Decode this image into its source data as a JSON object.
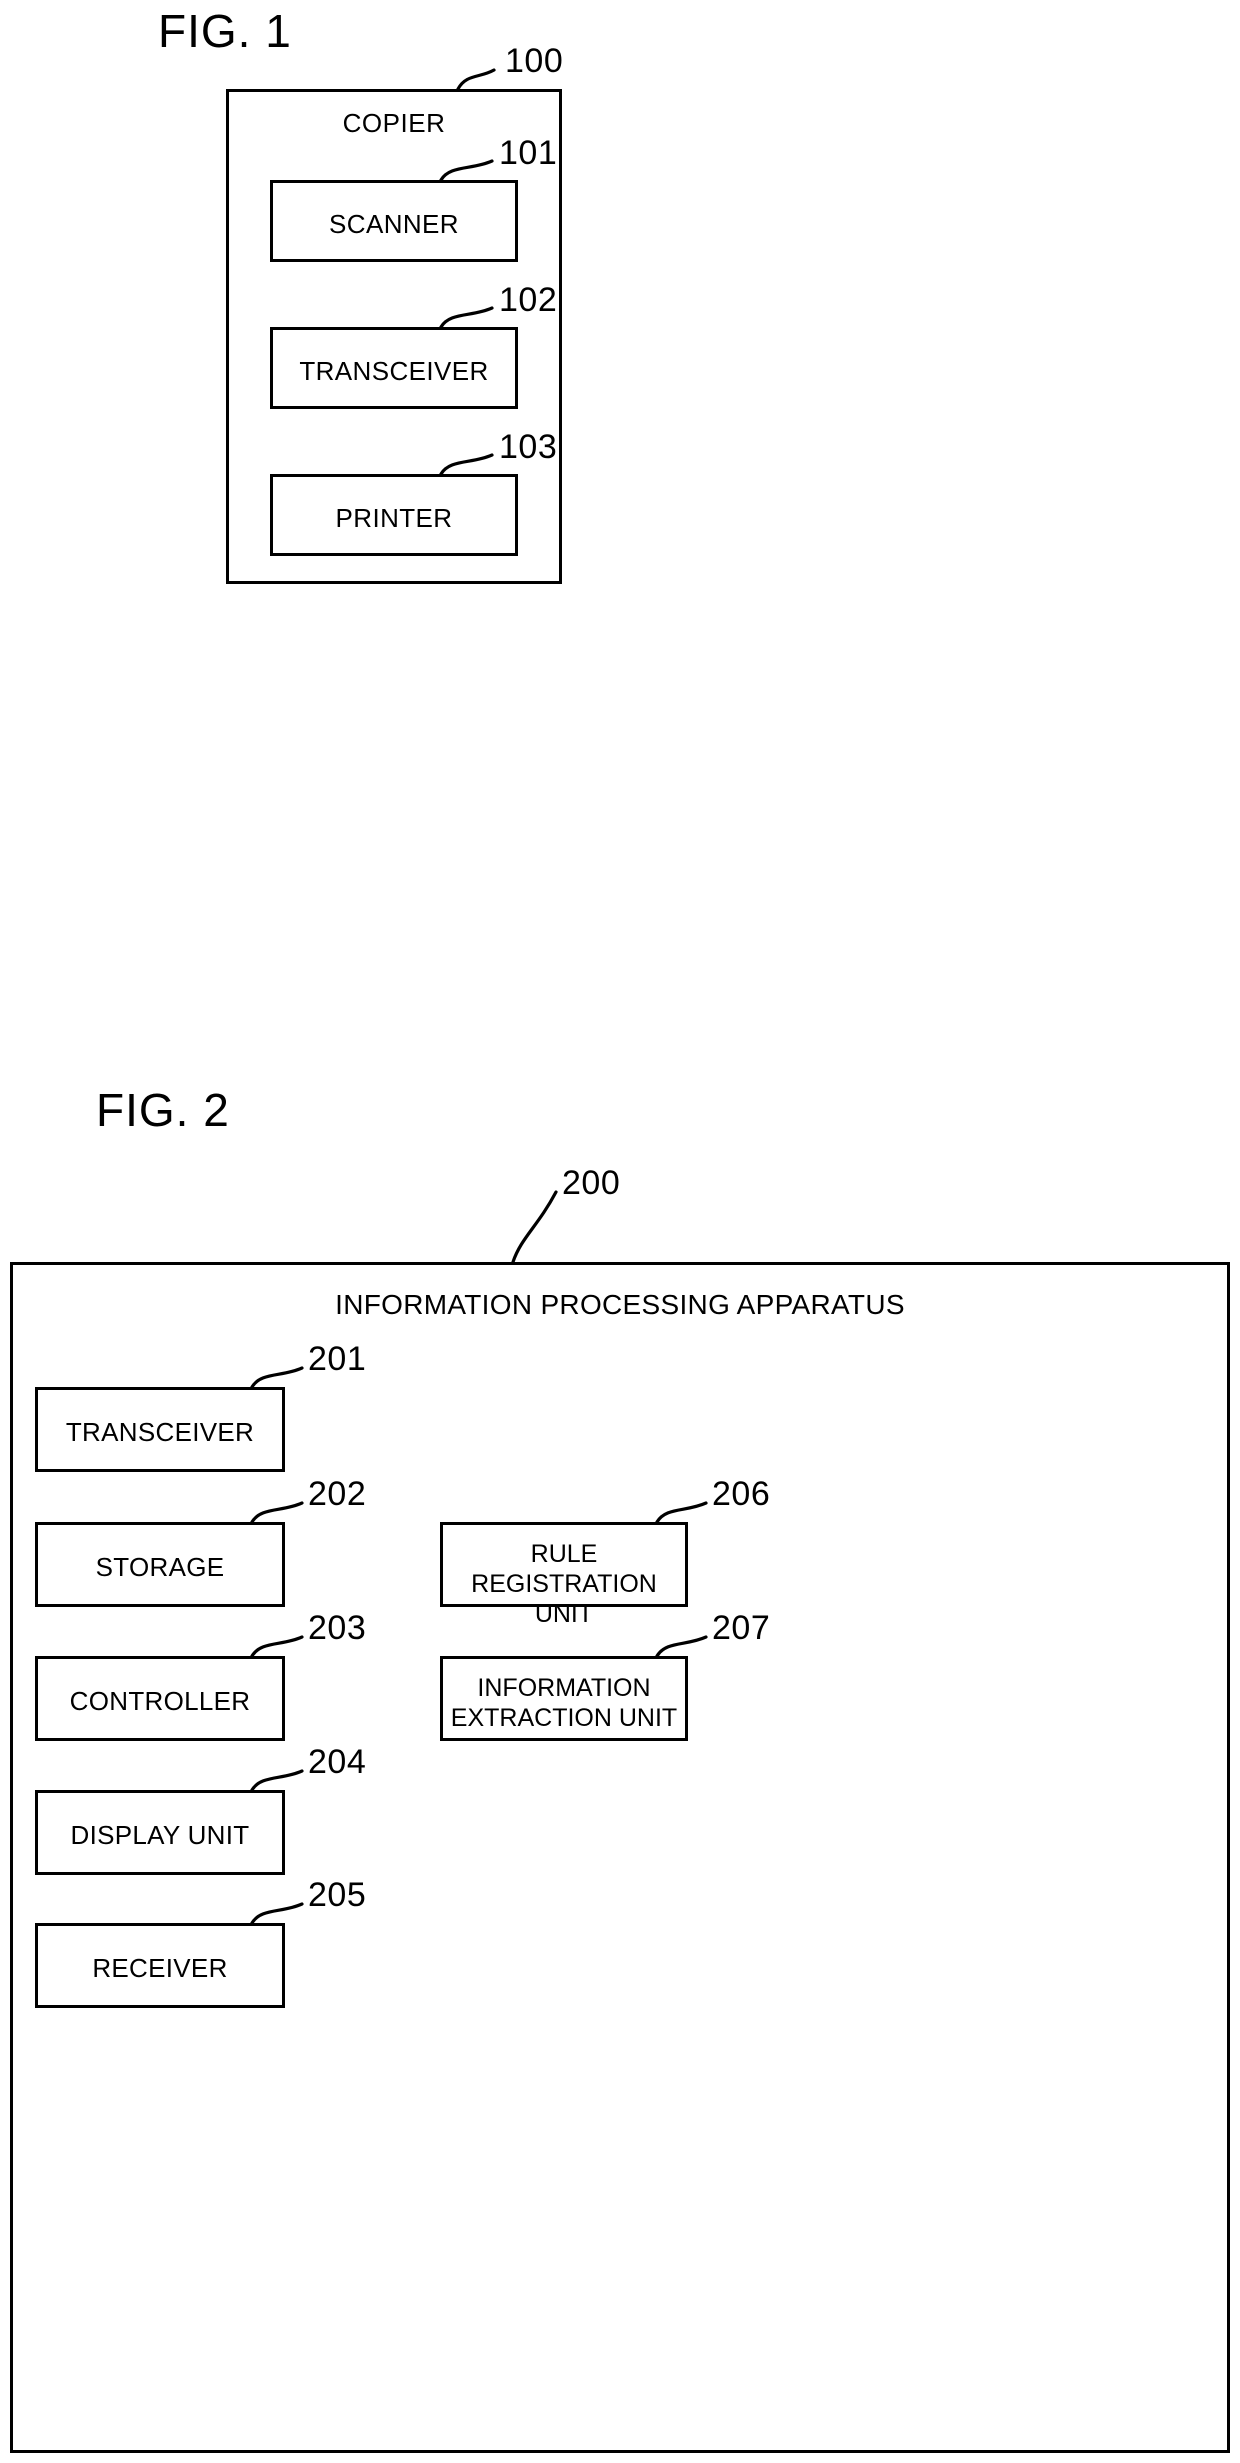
{
  "figures": [
    {
      "id": "fig1",
      "title": "FIG. 1",
      "container": {
        "label": "COPIER",
        "ref": "100"
      },
      "blocks": [
        {
          "label": "SCANNER",
          "ref": "101"
        },
        {
          "label": "TRANSCEIVER",
          "ref": "102"
        },
        {
          "label": "PRINTER",
          "ref": "103"
        }
      ]
    },
    {
      "id": "fig2",
      "title": "FIG. 2",
      "container": {
        "label": "INFORMATION PROCESSING APPARATUS",
        "ref": "200"
      },
      "left_blocks": [
        {
          "label": "TRANSCEIVER",
          "ref": "201"
        },
        {
          "label": "STORAGE",
          "ref": "202"
        },
        {
          "label": "CONTROLLER",
          "ref": "203"
        },
        {
          "label": "DISPLAY UNIT",
          "ref": "204"
        },
        {
          "label": "RECEIVER",
          "ref": "205"
        }
      ],
      "right_blocks": [
        {
          "label": "RULE REGISTRATION\nUNIT",
          "ref": "206"
        },
        {
          "label": "INFORMATION\nEXTRACTION UNIT",
          "ref": "207"
        }
      ]
    }
  ],
  "colors": {
    "stroke": "#000000",
    "background": "#ffffff"
  }
}
